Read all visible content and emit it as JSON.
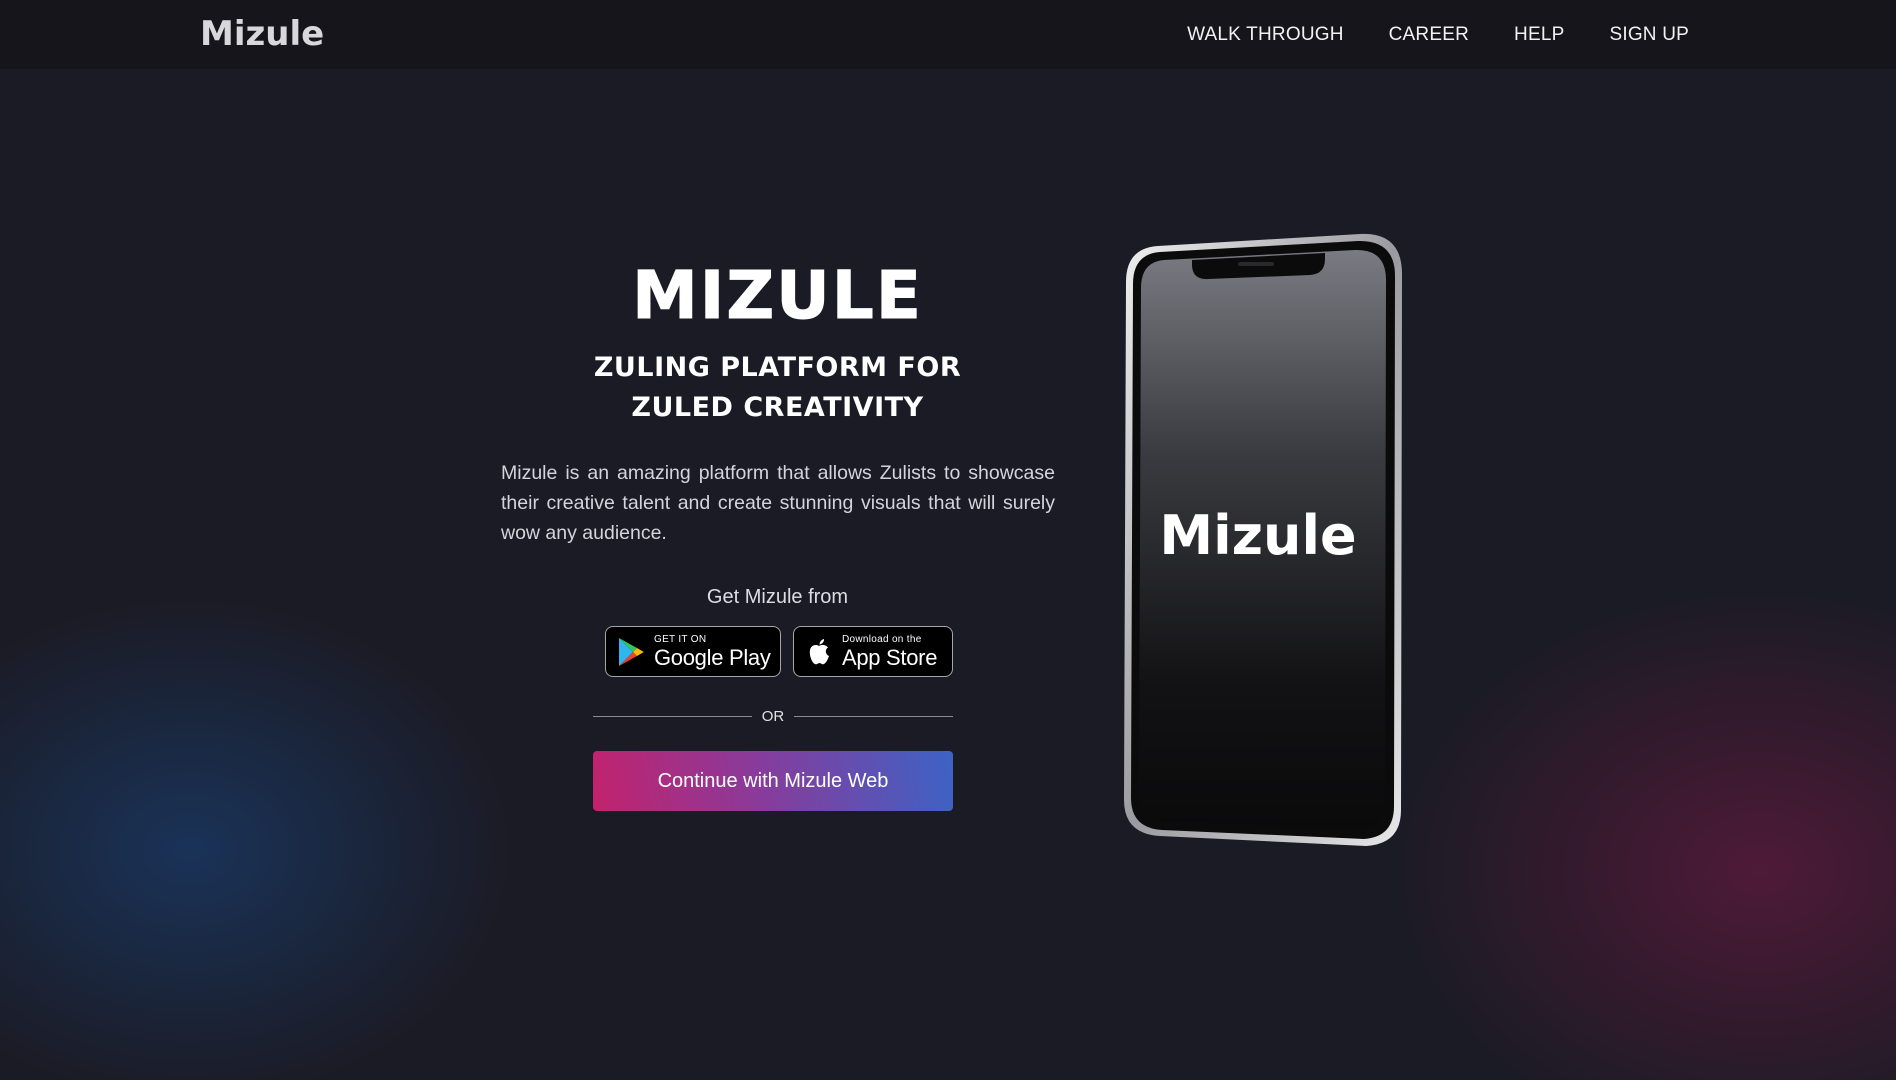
{
  "header": {
    "logo_text": "Mizule",
    "nav": [
      {
        "label": "WALK THROUGH"
      },
      {
        "label": "CAREER"
      },
      {
        "label": "HELP"
      },
      {
        "label": "SIGN UP"
      }
    ]
  },
  "hero": {
    "title": "MIZULE",
    "subtitle_line1": "ZULING PLATFORM FOR",
    "subtitle_line2": "ZULED CREATIVITY",
    "description": "Mizule is an amazing platform that allows Zulists to showcase their creative talent and create stunning visuals that will surely wow any audience.",
    "get_from": "Get Mizule from",
    "google_play": {
      "small": "GET IT ON",
      "big": "Google Play"
    },
    "app_store": {
      "small": "Download on the",
      "big": "App Store"
    },
    "or_text": "OR",
    "cta_label": "Continue with Mizule Web"
  },
  "phone": {
    "screen_logo": "Mizule"
  },
  "colors": {
    "background": "#1b1b25",
    "topbar": "#15151b",
    "cta_gradient_start": "#c3226c",
    "cta_gradient_end": "#3c63c6"
  }
}
